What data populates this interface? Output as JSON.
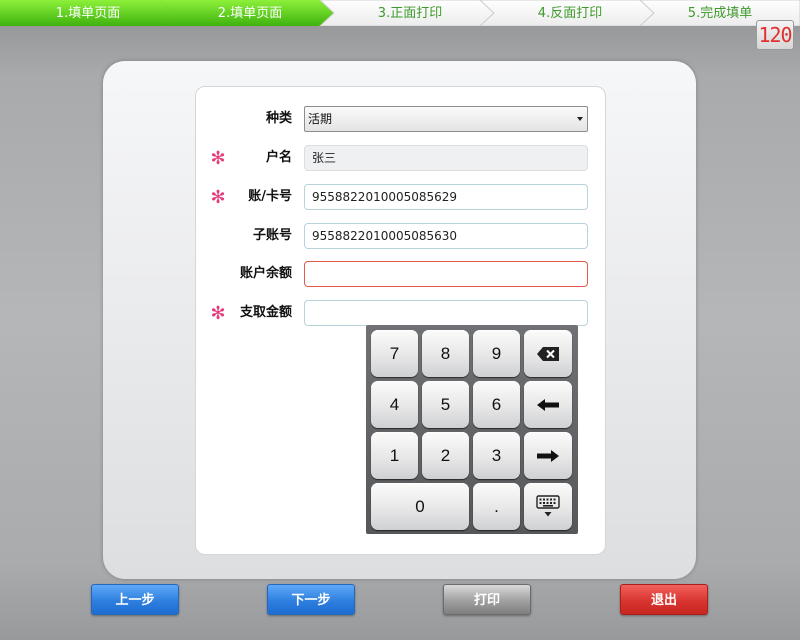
{
  "steps": [
    {
      "label": "1.填单页面",
      "state": "done"
    },
    {
      "label": "2.填单页面",
      "state": "done"
    },
    {
      "label": "3.正面打印",
      "state": "todo"
    },
    {
      "label": "4.反面打印",
      "state": "todo"
    },
    {
      "label": "5.完成填单",
      "state": "todo"
    }
  ],
  "timer": "120",
  "form": {
    "type_label": "种类",
    "type_value": "活期",
    "name_label": "户名",
    "name_value": "张三",
    "account_label": "账/卡号",
    "account_value": "9558822010005085629",
    "subaccount_label": "子账号",
    "subaccount_value": "9558822010005085630",
    "balance_label": "账户余额",
    "balance_value": "",
    "withdraw_label": "支取金额",
    "withdraw_value": "",
    "required_mark": "✻"
  },
  "keypad": {
    "keys": [
      "7",
      "8",
      "9",
      "4",
      "5",
      "6",
      "1",
      "2",
      "3",
      "0",
      "."
    ],
    "icons": [
      "backspace-icon",
      "arrow-left-icon",
      "arrow-right-icon",
      "keyboard-hide-icon"
    ]
  },
  "buttons": {
    "prev": "上一步",
    "next": "下一步",
    "print": "打印",
    "exit": "退出"
  },
  "colors": {
    "step_done": "#5ccd1c",
    "step_todo": "#ffffff",
    "required": "#e63a7a",
    "error_border": "#e55a4e",
    "primary": "#2e7fe0",
    "danger": "#d93530"
  }
}
